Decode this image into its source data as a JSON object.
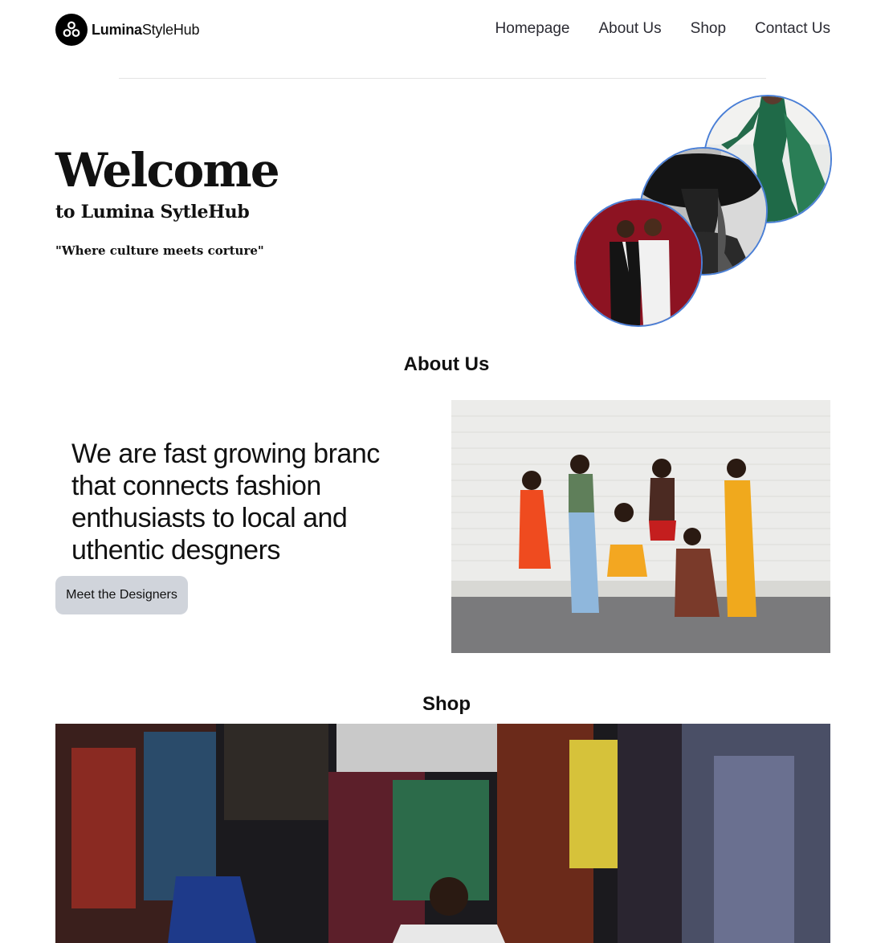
{
  "brand": {
    "name_bold": "Lumina",
    "name_light": "StyleHub"
  },
  "nav": {
    "links": [
      "Homepage",
      "About Us",
      "Shop",
      "Contact Us"
    ]
  },
  "hero": {
    "title": "Welcome",
    "subtitle": "to Lumina SytleHub",
    "tagline": "\"Where culture meets corture\""
  },
  "about": {
    "heading": "About Us",
    "text": "We are fast growing branc that connects fashion enthusiasts to local and uthentic desgners",
    "button_label": "Meet the Designers"
  },
  "shop": {
    "heading": "Shop"
  },
  "colors": {
    "accent_border": "#4a7fd6",
    "button_bg": "#d0d4db"
  }
}
